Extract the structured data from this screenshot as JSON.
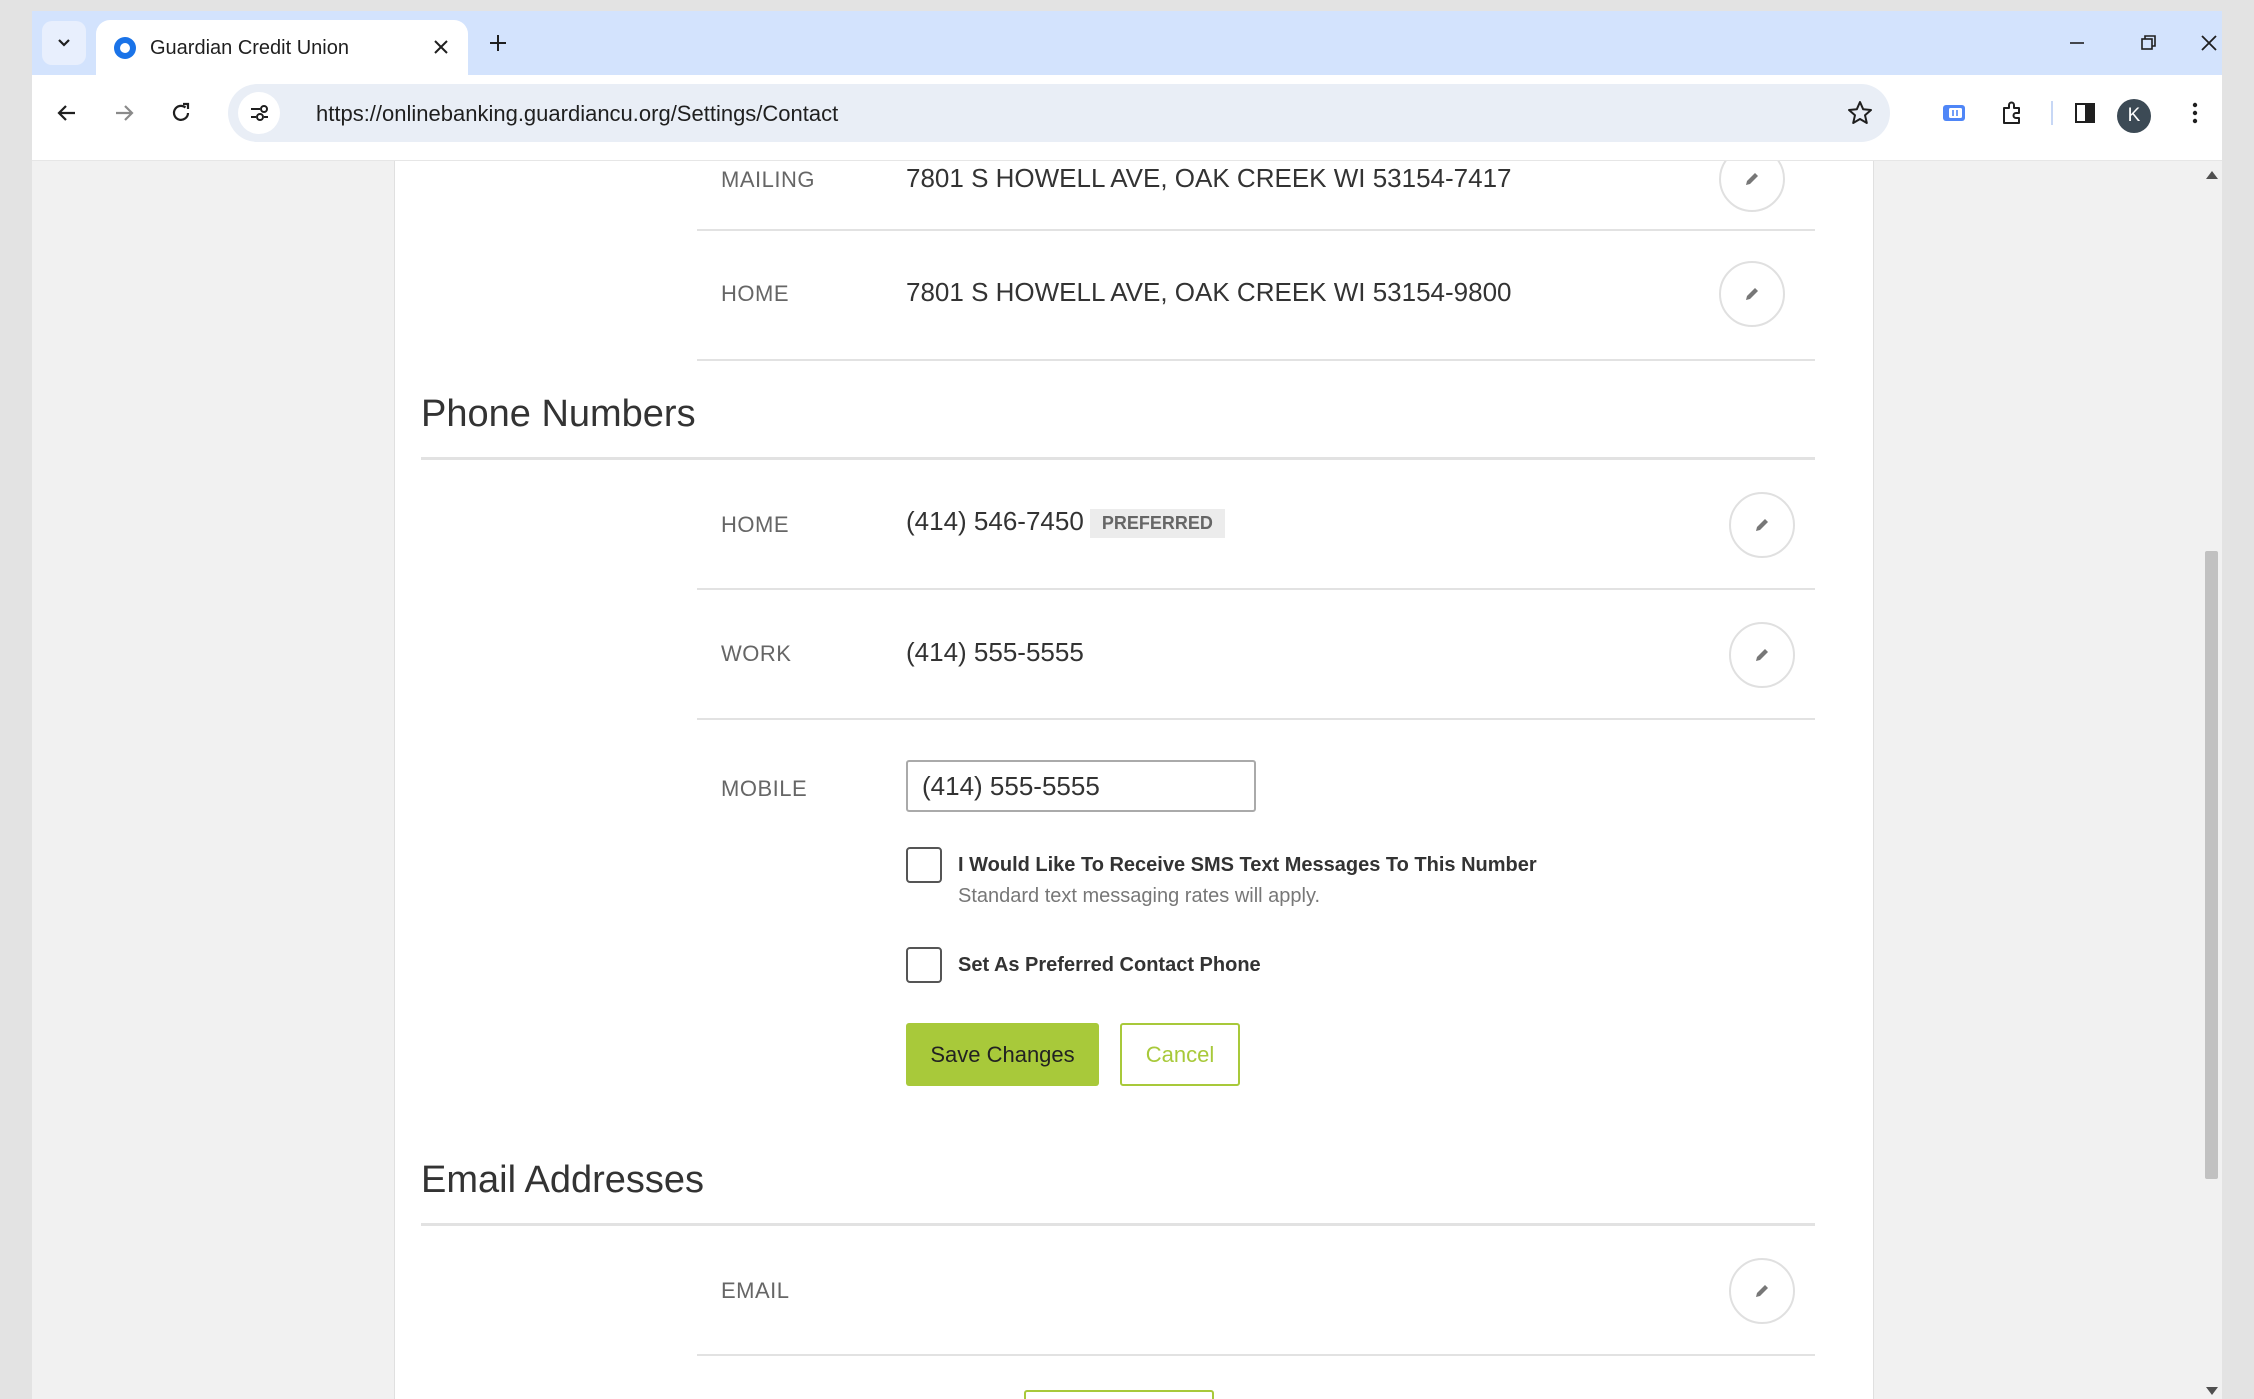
{
  "browser": {
    "tab_title": "Guardian Credit Union",
    "url": "https://onlinebanking.guardiancu.org/Settings/Contact",
    "profile_initial": "K",
    "icons": [
      "tab-search-icon",
      "favicon-icon",
      "close-icon",
      "new-tab-icon",
      "minimize-icon",
      "restore-icon",
      "window-close-icon",
      "back-icon",
      "forward-icon",
      "reload-icon",
      "site-info-icon",
      "star-icon",
      "extension-icon",
      "puzzle-icon",
      "side-panel-icon",
      "menu-icon"
    ]
  },
  "addresses": {
    "mailing": {
      "label": "MAILING",
      "value": "7801 S HOWELL AVE, OAK CREEK WI 53154-7417"
    },
    "home": {
      "label": "HOME",
      "value": "7801 S HOWELL AVE, OAK CREEK WI 53154-9800"
    }
  },
  "phone_section": {
    "title": "Phone Numbers",
    "home": {
      "label": "HOME",
      "value": "(414) 546-7450",
      "badge": "PREFERRED"
    },
    "work": {
      "label": "WORK",
      "value": "(414) 555-5555"
    },
    "mobile": {
      "label": "MOBILE",
      "input_value": "(414) 555-5555",
      "sms_label": "I Would Like To Receive SMS Text Messages To This Number",
      "sms_note": "Standard text messaging rates will apply.",
      "sms_checked": false,
      "preferred_label": "Set As Preferred Contact Phone",
      "preferred_checked": false,
      "save_label": "Save Changes",
      "cancel_label": "Cancel"
    }
  },
  "email_section": {
    "title": "Email Addresses",
    "email": {
      "label": "EMAIL",
      "value": ""
    }
  },
  "colors": {
    "accent": "#a8c93a",
    "tabstrip": "#d3e3fd",
    "page_bg": "#f1f1f1"
  }
}
